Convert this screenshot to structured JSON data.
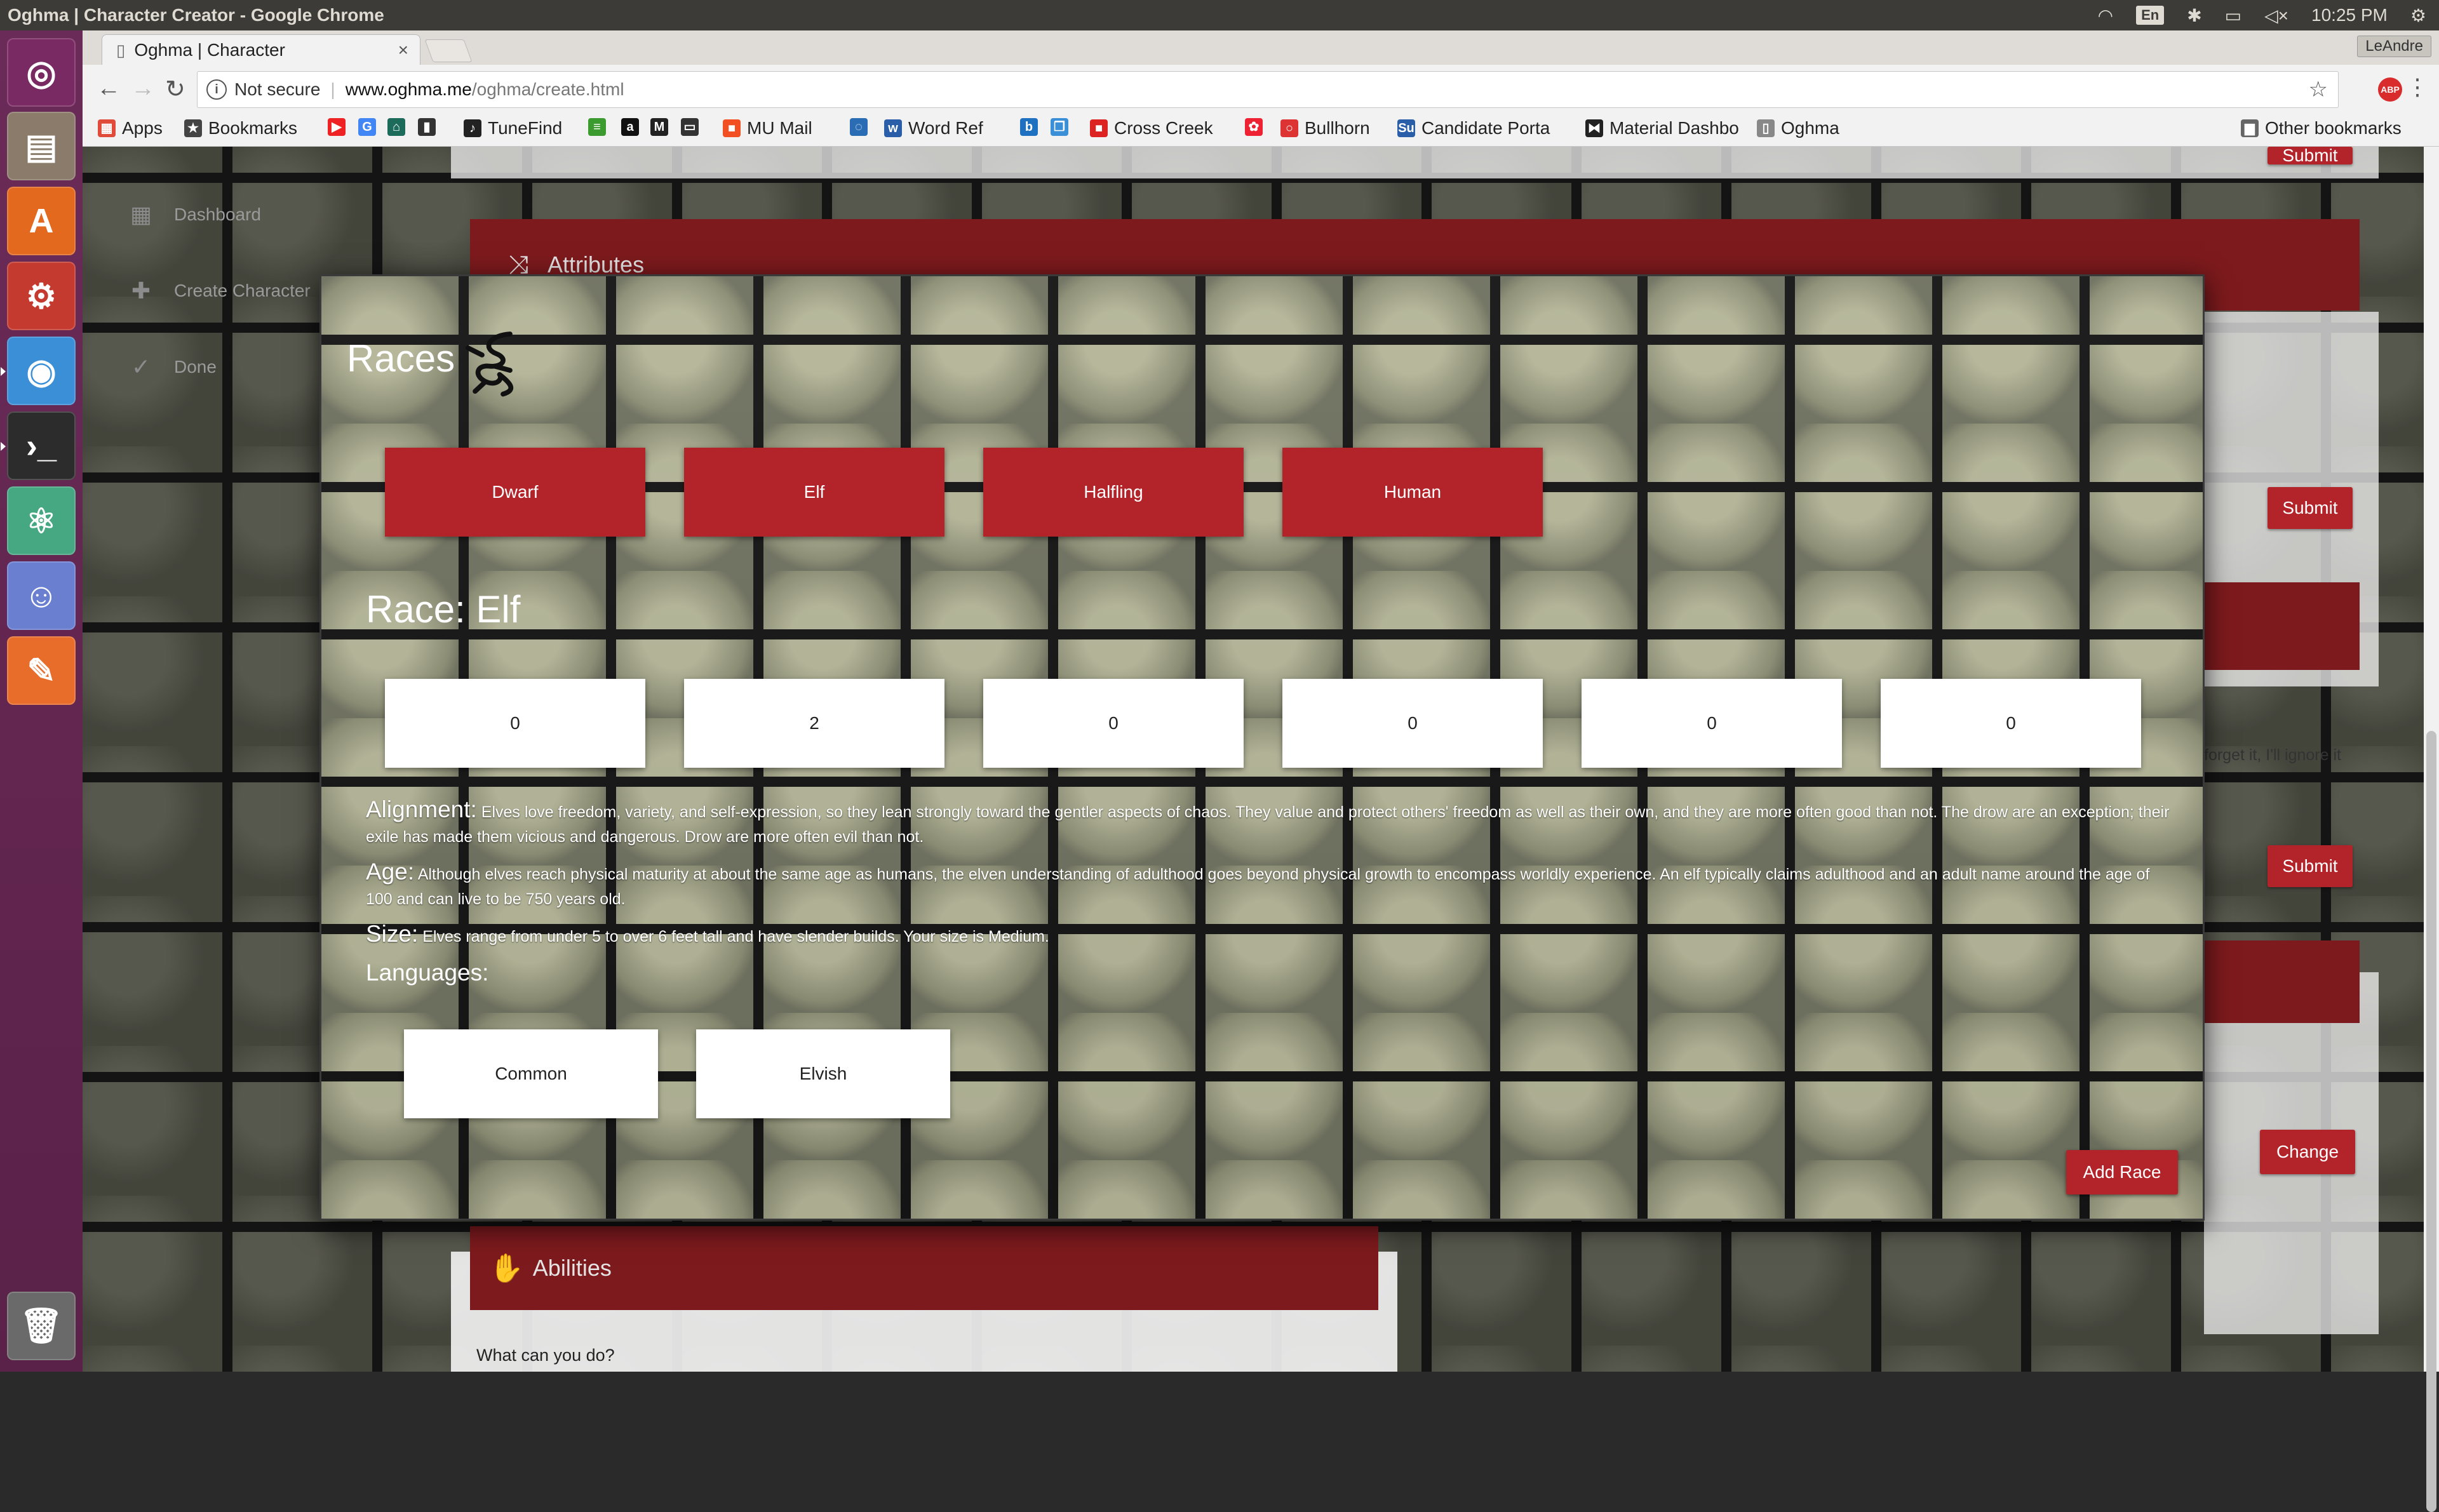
{
  "os": {
    "window_title": "Oghma | Character Creator - Google Chrome",
    "keyboard": "En",
    "time": "10:25 PM"
  },
  "launcher": [
    {
      "name": "ubuntu-logo-icon",
      "color": "#7a2a63",
      "glyph": "◎"
    },
    {
      "name": "files-icon",
      "color": "#8a7b6a",
      "glyph": "▤"
    },
    {
      "name": "software-center-icon",
      "color": "#e2691e",
      "glyph": "A"
    },
    {
      "name": "system-settings-icon",
      "color": "#c43a2f",
      "glyph": "⚙"
    },
    {
      "name": "chrome-icon",
      "color": "#3b8fd6",
      "glyph": "◉"
    },
    {
      "name": "terminal-icon",
      "color": "#2c2c2c",
      "glyph": "›_"
    },
    {
      "name": "atom-icon",
      "color": "#46a882",
      "glyph": "⚛"
    },
    {
      "name": "discord-icon",
      "color": "#6a7fd0",
      "glyph": "☺"
    },
    {
      "name": "editor-icon",
      "color": "#e86c2a",
      "glyph": "✎"
    },
    {
      "name": "trash-icon",
      "color": "#6a6a6a",
      "glyph": "🗑"
    }
  ],
  "browser": {
    "tab_title": "Oghma | Character",
    "user": "LeAndre",
    "security": "Not secure",
    "url_host": "www.oghma.me",
    "url_path": "/oghma/create.html",
    "bookmarks": [
      {
        "label": "Apps",
        "color": "#e04b3a",
        "glyph": "▦"
      },
      {
        "label": "Bookmarks",
        "color": "#444",
        "glyph": "★"
      },
      {
        "label": "",
        "color": "#e22",
        "glyph": "▶"
      },
      {
        "label": "",
        "color": "#4285f4",
        "glyph": "G"
      },
      {
        "label": "",
        "color": "#1d6b5a",
        "glyph": "⌂"
      },
      {
        "label": "",
        "color": "#333",
        "glyph": "▮"
      },
      {
        "label": "TuneFind",
        "color": "#222",
        "glyph": "♪"
      },
      {
        "label": "",
        "color": "#3c9b2e",
        "glyph": "≡"
      },
      {
        "label": "",
        "color": "#111",
        "glyph": "a"
      },
      {
        "label": "",
        "color": "#222",
        "glyph": "M"
      },
      {
        "label": "",
        "color": "#333",
        "glyph": "▭"
      },
      {
        "label": "MU Mail",
        "color": "#f25022",
        "glyph": "■"
      },
      {
        "label": "",
        "color": "#2a6db5",
        "glyph": "◌"
      },
      {
        "label": "Word Ref",
        "color": "#2a5ea8",
        "glyph": "w"
      },
      {
        "label": "",
        "color": "#1e70c1",
        "glyph": "b"
      },
      {
        "label": "",
        "color": "#3a8fd6",
        "glyph": "❐"
      },
      {
        "label": "Cross Creek",
        "color": "#d22",
        "glyph": "■"
      },
      {
        "label": "",
        "color": "#e23",
        "glyph": "✿"
      },
      {
        "label": "Bullhorn",
        "color": "#d33",
        "glyph": "○"
      },
      {
        "label": "Candidate Porta",
        "color": "#2a5ea8",
        "glyph": "Su"
      },
      {
        "label": "Material Dashbo",
        "color": "#222",
        "glyph": "⧓"
      },
      {
        "label": "Oghma",
        "color": "#888",
        "glyph": "▯"
      },
      {
        "label": "Other bookmarks",
        "color": "#666",
        "glyph": "▆"
      }
    ]
  },
  "sidebar": {
    "items": [
      {
        "label": "Dashboard",
        "icon": "dashboard-icon"
      },
      {
        "label": "Create Character",
        "icon": "person-add-icon"
      },
      {
        "label": "Done",
        "icon": "check-icon"
      }
    ]
  },
  "background": {
    "attributes_header": "Attributes",
    "abilities_header": "Abilities",
    "abilities_prompt": "What can you do?",
    "submit_label": "Submit",
    "change_label": "Change",
    "hint_text": "forget it, I'll ignore it"
  },
  "modal": {
    "title": "Races",
    "races": [
      "Dwarf",
      "Elf",
      "Halfling",
      "Human"
    ],
    "selected_heading": "Race: Elf",
    "stats": [
      "0",
      "2",
      "0",
      "0",
      "0",
      "0"
    ],
    "alignment_label": "Alignment:",
    "alignment_text": "Elves love freedom, variety, and self-expression, so they lean strongly toward the gentler aspects of chaos. They value and protect others' freedom as well as their own, and they are more often good than not. The drow are an exception; their exile has made them vicious and dangerous. Drow are more often evil than not.",
    "age_label": "Age:",
    "age_text": "Although elves reach physical maturity at about the same age as humans, the elven understanding of adulthood goes beyond physical growth to encompass worldly experience. An elf typically claims adulthood and an adult name around the age of 100 and can live to be 750 years old.",
    "size_label": "Size:",
    "size_text": "Elves range from under 5 to over 6 feet tall and have slender builds. Your size is Medium.",
    "languages_label": "Languages:",
    "languages": [
      "Common",
      "Elvish"
    ],
    "add_button": "Add Race"
  },
  "colors": {
    "accent_red": "#b3242a",
    "header_dark_red": "#7d1a1d",
    "launcher_purple": "#6b2b58"
  }
}
